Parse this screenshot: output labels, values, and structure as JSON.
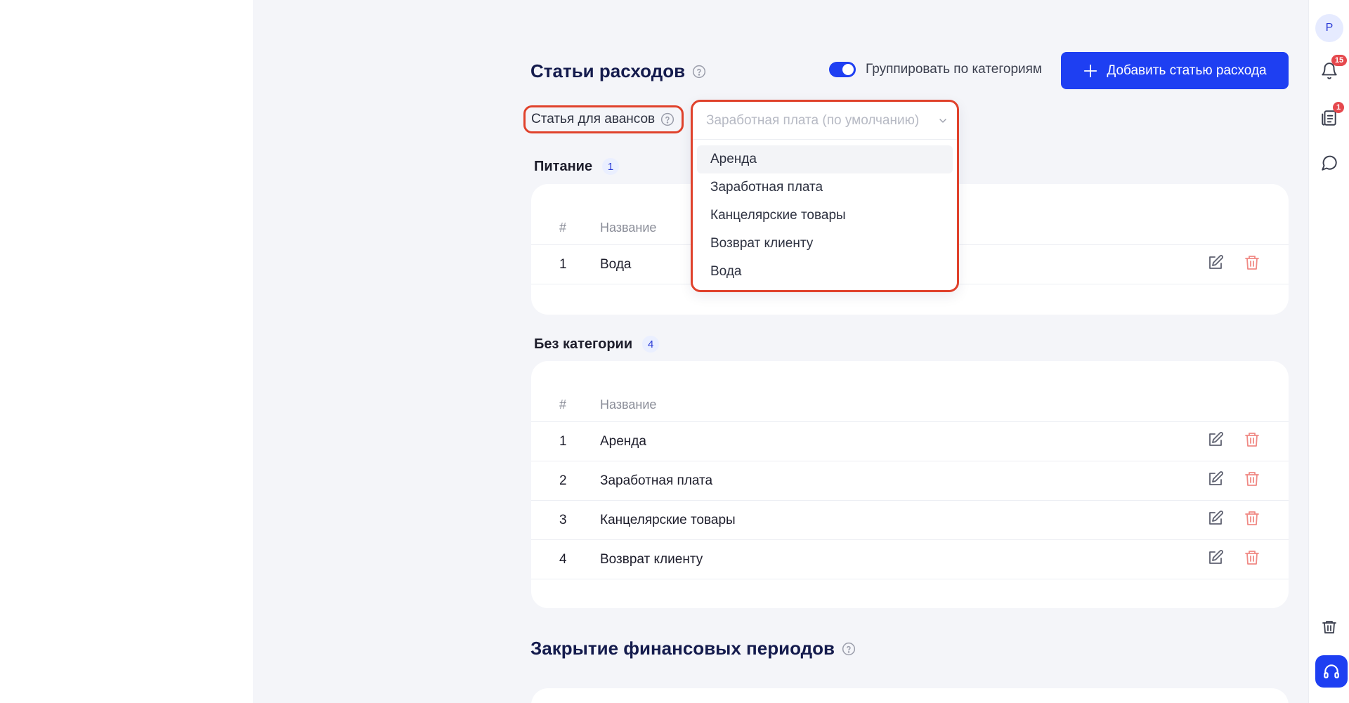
{
  "user": {
    "avatar_initial": "Р"
  },
  "rail": {
    "notifications_count": "15",
    "docs_count": "1"
  },
  "expenses": {
    "title": "Статьи расходов",
    "group_toggle_label": "Группировать по категориям",
    "group_toggle_on": true,
    "add_button_label": "Добавить статью расхода",
    "advance_label": "Статья для авансов",
    "advance_select_placeholder": "Заработная плата (по умолчанию)",
    "dropdown_options": [
      "Аренда",
      "Заработная плата",
      "Канцелярские товары",
      "Возврат клиенту",
      "Вода"
    ],
    "columns": {
      "num": "#",
      "name": "Название"
    },
    "groups": [
      {
        "name": "Питание",
        "count": "1",
        "rows": [
          {
            "num": "1",
            "name": "Вода"
          }
        ]
      },
      {
        "name": "Без категории",
        "count": "4",
        "rows": [
          {
            "num": "1",
            "name": "Аренда"
          },
          {
            "num": "2",
            "name": "Заработная плата"
          },
          {
            "num": "3",
            "name": "Канцелярские товары"
          },
          {
            "num": "4",
            "name": "Возврат клиенту"
          }
        ]
      }
    ]
  },
  "periods": {
    "title": "Закрытие финансовых периодов"
  },
  "colors": {
    "accent": "#1e3ff2",
    "highlight": "#e0422c",
    "delete": "#f08a85"
  }
}
